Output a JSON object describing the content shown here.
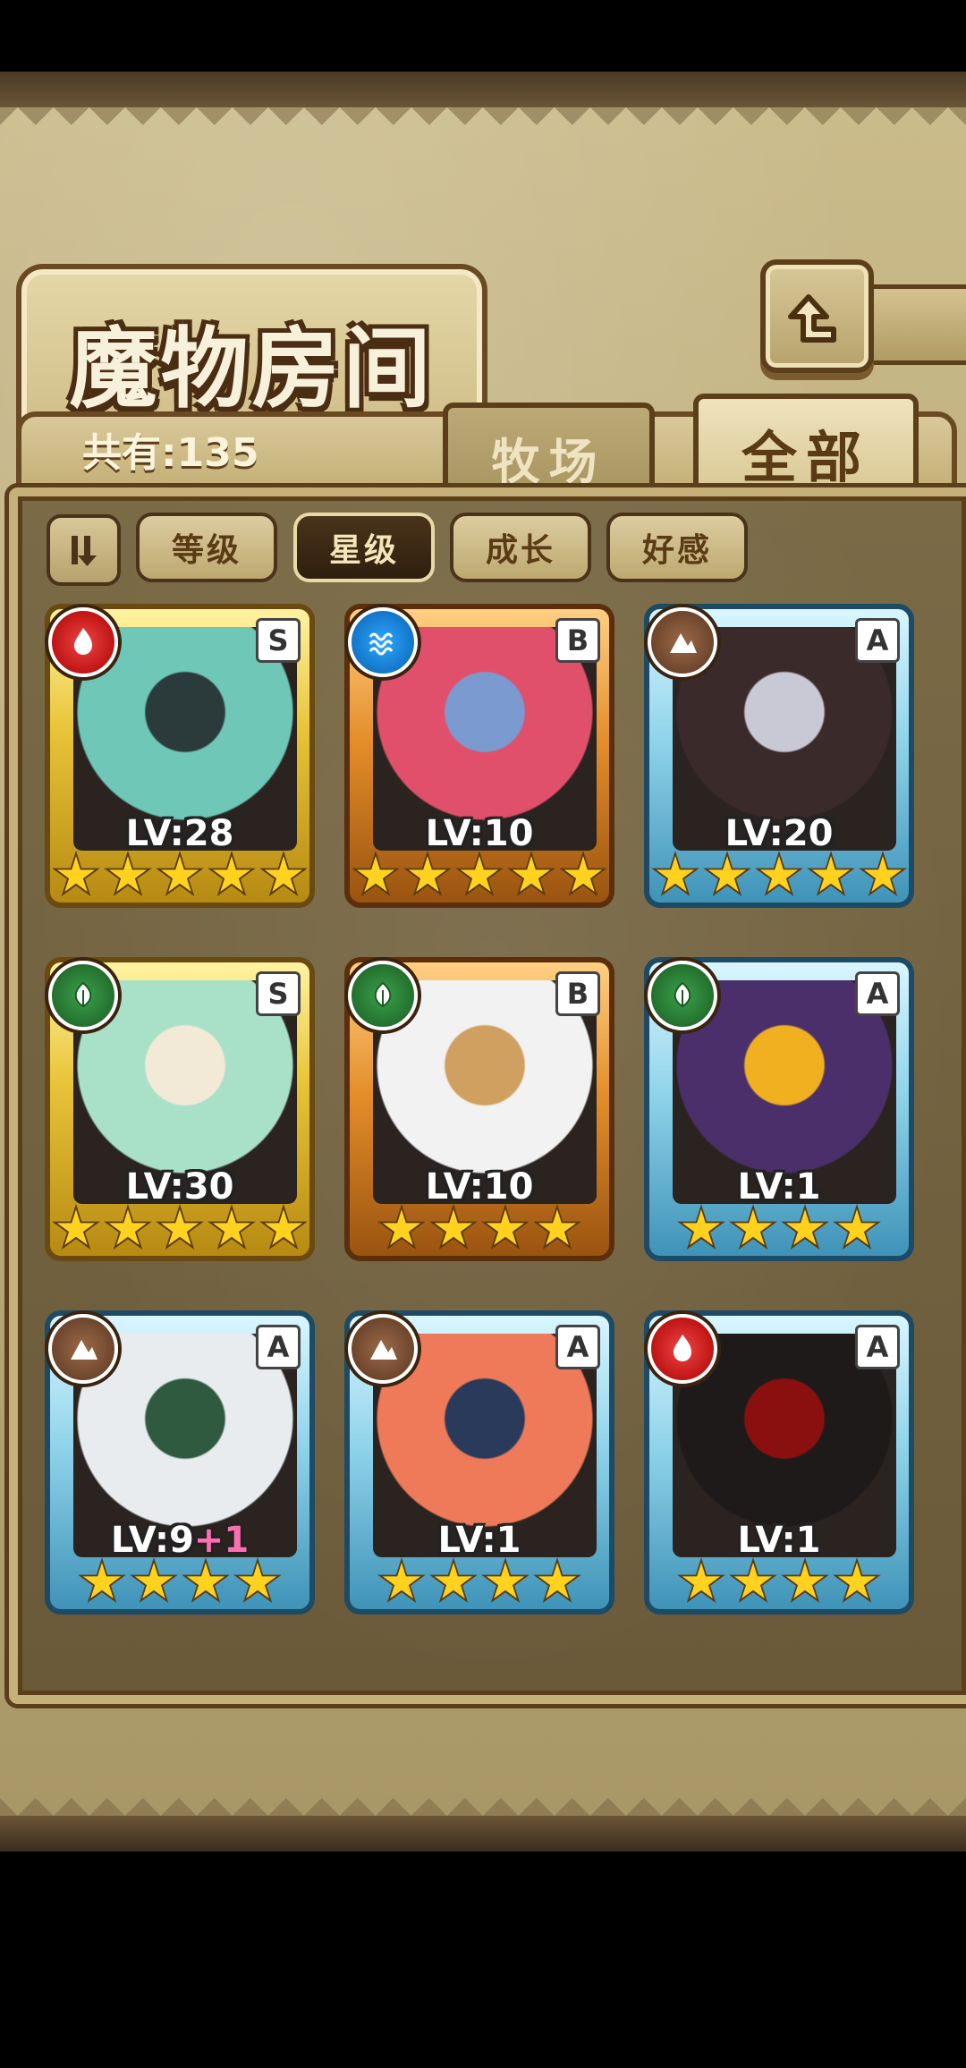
{
  "screen": {
    "title": "魔物房间"
  },
  "header": {
    "count_label": "共有:135"
  },
  "tabs": [
    {
      "label": "牧场",
      "selected": false
    },
    {
      "label": "全部",
      "selected": true
    }
  ],
  "filters": [
    {
      "label": "等级",
      "selected": false
    },
    {
      "label": "星级",
      "selected": true
    },
    {
      "label": "成长",
      "selected": false
    },
    {
      "label": "好感",
      "selected": false
    }
  ],
  "monsters": [
    {
      "level": "LV:28",
      "plus": "",
      "rank": "S",
      "element": "fire",
      "frame": "gold",
      "stars": 5,
      "art": [
        "#6fc7b8",
        "#2b3a3a"
      ]
    },
    {
      "level": "LV:10",
      "plus": "",
      "rank": "B",
      "element": "water",
      "frame": "bronze",
      "stars": 5,
      "art": [
        "#e0506a",
        "#7a9ad0"
      ]
    },
    {
      "level": "LV:20",
      "plus": "",
      "rank": "A",
      "element": "earth",
      "frame": "blue",
      "stars": 5,
      "art": [
        "#3a2a2a",
        "#c9c9d6"
      ]
    },
    {
      "level": "LV:30",
      "plus": "",
      "rank": "S",
      "element": "wood",
      "frame": "gold",
      "stars": 5,
      "art": [
        "#a9e0c8",
        "#f2ead6"
      ]
    },
    {
      "level": "LV:10",
      "plus": "",
      "rank": "B",
      "element": "wood",
      "frame": "bronze",
      "stars": 4,
      "art": [
        "#f2f2f2",
        "#d0a060"
      ]
    },
    {
      "level": "LV:1",
      "plus": "",
      "rank": "A",
      "element": "wood",
      "frame": "blue",
      "stars": 4,
      "art": [
        "#4a2f6a",
        "#f0b020"
      ]
    },
    {
      "level": "LV:9",
      "plus": "+1",
      "rank": "A",
      "element": "earth",
      "frame": "blue",
      "stars": 4,
      "art": [
        "#e8ecef",
        "#2f5a3f"
      ]
    },
    {
      "level": "LV:1",
      "plus": "",
      "rank": "A",
      "element": "earth",
      "frame": "blue",
      "stars": 4,
      "art": [
        "#ef7a5a",
        "#2a3a5a"
      ]
    },
    {
      "level": "LV:1",
      "plus": "",
      "rank": "A",
      "element": "fire",
      "frame": "blue",
      "stars": 4,
      "art": [
        "#1e1a1a",
        "#8a1010"
      ]
    }
  ]
}
